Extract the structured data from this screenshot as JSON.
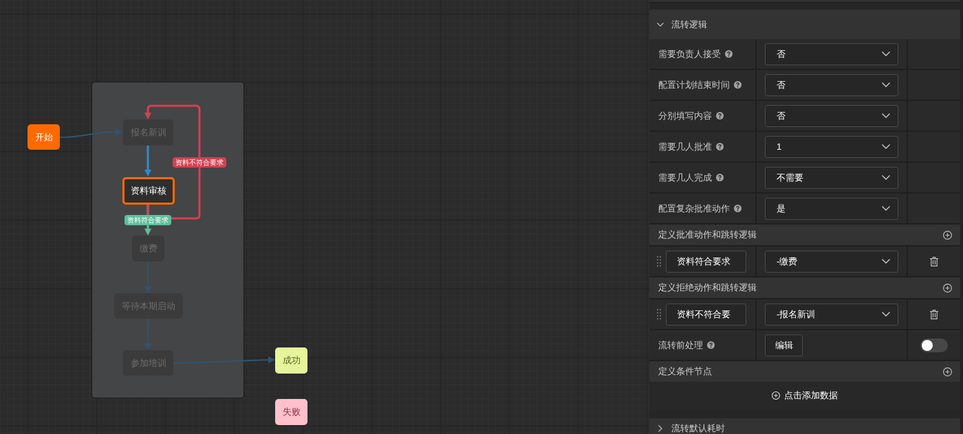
{
  "canvas": {
    "nodes": [
      {
        "label": "开始",
        "kind": "start",
        "selected": false
      },
      {
        "label": "报名新训",
        "kind": "task",
        "selected": false
      },
      {
        "label": "资料审核",
        "kind": "task",
        "selected": true
      },
      {
        "label": "缴费",
        "kind": "task",
        "selected": false
      },
      {
        "label": "等待本期启动",
        "kind": "task",
        "selected": false
      },
      {
        "label": "参加培训",
        "kind": "task",
        "selected": false
      },
      {
        "label": "成功",
        "kind": "success",
        "selected": false
      },
      {
        "label": "失败",
        "kind": "fail",
        "selected": false
      }
    ],
    "edges": [
      {
        "kind": "normal",
        "highlighted": false
      },
      {
        "kind": "normal",
        "highlighted": true
      },
      {
        "kind": "reject",
        "highlighted": true,
        "label": "资料不符合要求"
      },
      {
        "kind": "approve",
        "highlighted": true,
        "label": "资料符合要求"
      },
      {
        "kind": "normal",
        "highlighted": false
      },
      {
        "kind": "normal",
        "highlighted": false
      },
      {
        "kind": "normal",
        "highlighted": false
      }
    ]
  },
  "panel": {
    "flow_logic": {
      "title": "流转逻辑",
      "expanded": true
    },
    "settings": [
      {
        "label": "需要负责人接受",
        "value": "否"
      },
      {
        "label": "配置计划结束时间",
        "value": "否"
      },
      {
        "label": "分别填写内容",
        "value": "否"
      },
      {
        "label": "需要几人批准",
        "value": "1"
      },
      {
        "label": "需要几人完成",
        "value": "不需要"
      },
      {
        "label": "配置复杂批准动作",
        "value": "是"
      }
    ],
    "approve_actions": {
      "title": "定义批准动作和跳转逻辑",
      "rows": [
        {
          "name": "资料符合要求",
          "target": "-缴费"
        }
      ]
    },
    "reject_actions": {
      "title": "定义拒绝动作和跳转逻辑",
      "rows": [
        {
          "name": "资料不符合要",
          "target": "-报名新训"
        }
      ]
    },
    "pre_processing": {
      "label": "流转前处理",
      "button": "编辑",
      "on": false
    },
    "condition_nodes": {
      "title": "定义条件节点",
      "add_button": "点击添加数据"
    },
    "default_duration": {
      "title": "流转默认耗时",
      "expanded": false
    }
  }
}
